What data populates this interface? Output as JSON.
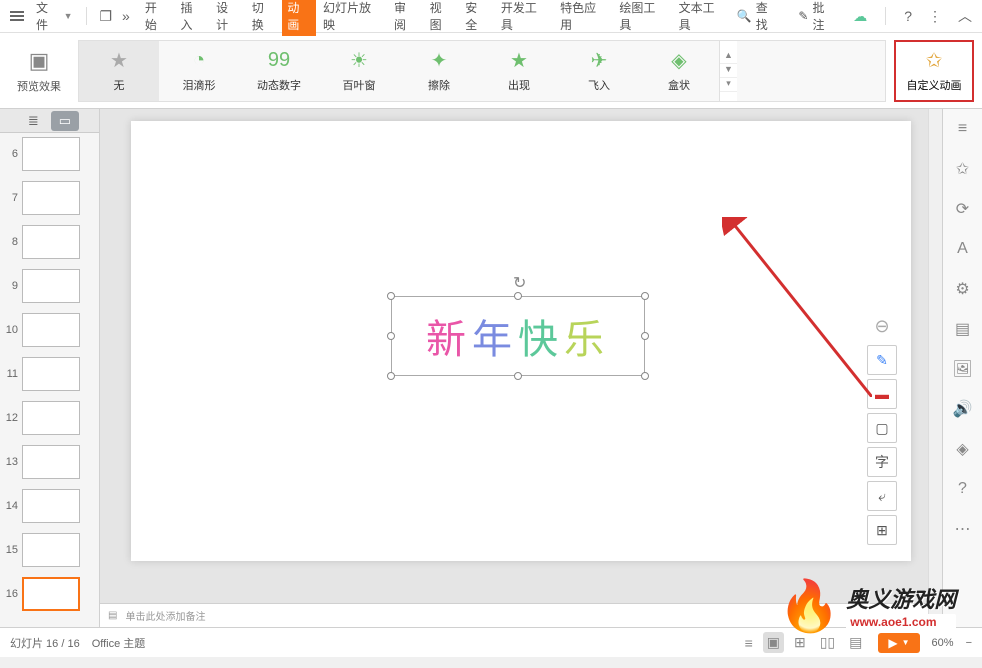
{
  "menubar": {
    "file_label": "文件",
    "tabs": [
      "开始",
      "插入",
      "设计",
      "切换",
      "动画",
      "幻灯片放映",
      "审阅",
      "视图",
      "安全",
      "开发工具",
      "特色应用",
      "绘图工具",
      "文本工具"
    ],
    "active_tab_index": 4,
    "search_label": "查找",
    "annotate_label": "批注"
  },
  "ribbon": {
    "preview_label": "预览效果",
    "effects": [
      {
        "label": "无",
        "icon": "★",
        "class": "gray none"
      },
      {
        "label": "泪滴形",
        "icon": "◔",
        "class": ""
      },
      {
        "label": "动态数字",
        "icon": "99",
        "class": ""
      },
      {
        "label": "百叶窗",
        "icon": "☀",
        "class": ""
      },
      {
        "label": "擦除",
        "icon": "✦",
        "class": ""
      },
      {
        "label": "出现",
        "icon": "★",
        "class": ""
      },
      {
        "label": "飞入",
        "icon": "✈",
        "class": ""
      },
      {
        "label": "盒状",
        "icon": "◈",
        "class": ""
      }
    ],
    "custom_label": "自定义动画"
  },
  "thumbs": [
    {
      "num": "6"
    },
    {
      "num": "7"
    },
    {
      "num": "8"
    },
    {
      "num": "9"
    },
    {
      "num": "10"
    },
    {
      "num": "11"
    },
    {
      "num": "12"
    },
    {
      "num": "13"
    },
    {
      "num": "14"
    },
    {
      "num": "15"
    },
    {
      "num": "16",
      "selected": true
    }
  ],
  "slide_text": {
    "c1": "新",
    "c2": "年",
    "c3": "快",
    "c4": "乐"
  },
  "notes_placeholder": "单击此处添加备注",
  "status": {
    "slide_index": "幻灯片 16 / 16",
    "theme": "Office 主题",
    "zoom": "60%"
  },
  "watermark": {
    "title": "奥义游戏网",
    "url": "www.aoe1.com"
  }
}
